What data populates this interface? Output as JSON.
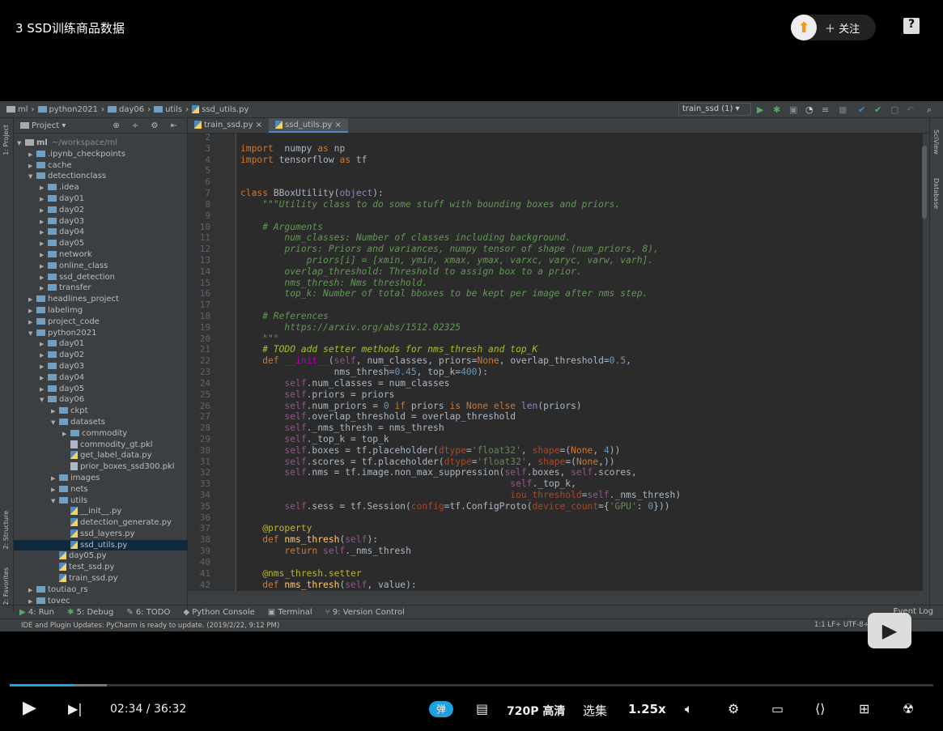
{
  "player": {
    "title": "3 SSD训练商品数据",
    "follow_label": "关注",
    "help_icon": "?",
    "time_current": "02:34",
    "time_total": "36:32",
    "played_fraction": 0.0705,
    "buffered_fraction": 0.105,
    "danmaku_label": "弹",
    "quality": "720P 高清",
    "episodes": "选集",
    "speed": "1.25x",
    "accent": "#1ea1e0"
  },
  "ide": {
    "breadcrumb": [
      "ml",
      "python2021",
      "day06",
      "utils",
      "ssd_utils.py"
    ],
    "run_config": "train_ssd (1)",
    "panel_title": "Project",
    "side_left": [
      "1: Project",
      "2: Structure",
      "2: Favorites"
    ],
    "side_right": [
      "SciView",
      "Database"
    ],
    "tabs": [
      {
        "label": "train_ssd.py",
        "active": false
      },
      {
        "label": "ssd_utils.py",
        "active": true
      }
    ],
    "tree": [
      {
        "l": 0,
        "t": "ml",
        "x": "~/workspace/ml",
        "o": 1
      },
      {
        "l": 1,
        "t": ".ipynb_checkpoints",
        "c": 1
      },
      {
        "l": 1,
        "t": "cache",
        "c": 1
      },
      {
        "l": 1,
        "t": "detectionclass",
        "o": 1
      },
      {
        "l": 2,
        "t": ".idea",
        "c": 1
      },
      {
        "l": 2,
        "t": "day01",
        "c": 1
      },
      {
        "l": 2,
        "t": "day02",
        "c": 1
      },
      {
        "l": 2,
        "t": "day03",
        "c": 1
      },
      {
        "l": 2,
        "t": "day04",
        "c": 1
      },
      {
        "l": 2,
        "t": "day05",
        "c": 1
      },
      {
        "l": 2,
        "t": "network",
        "c": 1
      },
      {
        "l": 2,
        "t": "online_class",
        "c": 1
      },
      {
        "l": 2,
        "t": "ssd_detection",
        "c": 1
      },
      {
        "l": 2,
        "t": "transfer",
        "c": 1
      },
      {
        "l": 1,
        "t": "headlines_project",
        "c": 1
      },
      {
        "l": 1,
        "t": "labelimg",
        "c": 1
      },
      {
        "l": 1,
        "t": "project_code",
        "c": 1
      },
      {
        "l": 1,
        "t": "python2021",
        "o": 1
      },
      {
        "l": 2,
        "t": "day01",
        "c": 1
      },
      {
        "l": 2,
        "t": "day02",
        "c": 1
      },
      {
        "l": 2,
        "t": "day03",
        "c": 1
      },
      {
        "l": 2,
        "t": "day04",
        "c": 1
      },
      {
        "l": 2,
        "t": "day05",
        "c": 1
      },
      {
        "l": 2,
        "t": "day06",
        "o": 1
      },
      {
        "l": 3,
        "t": "ckpt",
        "c": 1
      },
      {
        "l": 3,
        "t": "datasets",
        "o": 1
      },
      {
        "l": 4,
        "t": "commodity",
        "c": 1
      },
      {
        "l": 4,
        "t": "commodity_gt.pkl",
        "f": "file"
      },
      {
        "l": 4,
        "t": "get_label_data.py",
        "f": "py"
      },
      {
        "l": 4,
        "t": "prior_boxes_ssd300.pkl",
        "f": "file"
      },
      {
        "l": 3,
        "t": "images",
        "c": 1
      },
      {
        "l": 3,
        "t": "nets",
        "c": 1
      },
      {
        "l": 3,
        "t": "utils",
        "o": 1
      },
      {
        "l": 4,
        "t": "__init__.py",
        "f": "py"
      },
      {
        "l": 4,
        "t": "detection_generate.py",
        "f": "py"
      },
      {
        "l": 4,
        "t": "ssd_layers.py",
        "f": "py"
      },
      {
        "l": 4,
        "t": "ssd_utils.py",
        "f": "py",
        "sel": 1
      },
      {
        "l": 3,
        "t": "day05.py",
        "f": "py"
      },
      {
        "l": 3,
        "t": "test_ssd.py",
        "f": "py"
      },
      {
        "l": 3,
        "t": "train_ssd.py",
        "f": "py"
      },
      {
        "l": 1,
        "t": "toutiao_rs",
        "c": 1
      },
      {
        "l": 1,
        "t": "tovec",
        "c": 1
      }
    ],
    "first_line": 2,
    "code": [
      [],
      [
        [
          "k",
          "import"
        ],
        [
          "",
          "  numpy "
        ],
        [
          "k",
          "as"
        ],
        [
          "",
          " np"
        ]
      ],
      [
        [
          "k",
          "import"
        ],
        [
          "",
          " tensorflow "
        ],
        [
          "k",
          "as"
        ],
        [
          "",
          " tf"
        ]
      ],
      [],
      [],
      [
        [
          "k",
          "class"
        ],
        [
          "",
          " BBoxUtility("
        ],
        [
          "p",
          "object"
        ],
        [
          "",
          "):"
        ]
      ],
      [
        [
          "d",
          "    \"\"\"Utility class to do some stuff with bounding boxes and priors."
        ]
      ],
      [],
      [
        [
          "d",
          "    # Arguments"
        ]
      ],
      [
        [
          "d",
          "        num_classes: Number of classes including background."
        ]
      ],
      [
        [
          "d",
          "        priors: Priors and variances, numpy tensor of shape (num_priors, 8),"
        ]
      ],
      [
        [
          "d",
          "            priors[i] = [xmin, ymin, xmax, ymax, varxc, varyc, varw, varh]."
        ]
      ],
      [
        [
          "d",
          "        overlap_threshold: Threshold to assign box to a prior."
        ]
      ],
      [
        [
          "d",
          "        nms_thresh: Nms threshold."
        ]
      ],
      [
        [
          "d",
          "        top_k: Number of total bboxes to be kept per image after nms step."
        ]
      ],
      [],
      [
        [
          "d",
          "    # References"
        ]
      ],
      [
        [
          "d",
          "        https://arxiv.org/abs/1512.02325"
        ]
      ],
      [
        [
          "d",
          "    \"\"\""
        ]
      ],
      [
        [
          "todo",
          "    # TODO add setter methods for nms_thresh and top_K"
        ]
      ],
      [
        [
          "k",
          "    def "
        ],
        [
          "m",
          "__init__"
        ],
        [
          "",
          "("
        ],
        [
          "s",
          "self"
        ],
        [
          "",
          ", num_classes, priors="
        ],
        [
          "k",
          "None"
        ],
        [
          "",
          ", overlap_threshold="
        ],
        [
          "n",
          "0.5"
        ],
        [
          "",
          ","
        ]
      ],
      [
        [
          "",
          "                 nms_thresh="
        ],
        [
          "n",
          "0.45"
        ],
        [
          "",
          ", top_k="
        ],
        [
          "n",
          "400"
        ],
        [
          "",
          "):"
        ]
      ],
      [
        [
          "s",
          "        self"
        ],
        [
          "",
          ".num_classes = num_classes"
        ]
      ],
      [
        [
          "s",
          "        self"
        ],
        [
          "",
          ".priors = priors"
        ]
      ],
      [
        [
          "s",
          "        self"
        ],
        [
          "",
          ".num_priors = "
        ],
        [
          "n",
          "0"
        ],
        [
          "k",
          " if"
        ],
        [
          "",
          " priors "
        ],
        [
          "k",
          "is None else "
        ],
        [
          "p",
          "len"
        ],
        [
          "",
          "(priors)"
        ]
      ],
      [
        [
          "s",
          "        self"
        ],
        [
          "",
          ".overlap_threshold = overlap_threshold"
        ]
      ],
      [
        [
          "s",
          "        self"
        ],
        [
          "",
          "._nms_thresh = nms_thresh"
        ]
      ],
      [
        [
          "s",
          "        self"
        ],
        [
          "",
          "._top_k = top_k"
        ]
      ],
      [
        [
          "s",
          "        self"
        ],
        [
          "",
          ".boxes = tf.placeholder("
        ],
        [
          "kw",
          "dtype"
        ],
        [
          "",
          "="
        ],
        [
          "st",
          "'float32'"
        ],
        [
          "",
          ", "
        ],
        [
          "kw",
          "shape"
        ],
        [
          "",
          "=("
        ],
        [
          "k",
          "None"
        ],
        [
          "",
          ", "
        ],
        [
          "n",
          "4"
        ],
        [
          "",
          "))"
        ]
      ],
      [
        [
          "s",
          "        self"
        ],
        [
          "",
          ".scores = tf.placeholder("
        ],
        [
          "kw",
          "dtype"
        ],
        [
          "",
          "="
        ],
        [
          "st",
          "'float32'"
        ],
        [
          "",
          ", "
        ],
        [
          "kw",
          "shape"
        ],
        [
          "",
          "=("
        ],
        [
          "k",
          "None"
        ],
        [
          "",
          ",))"
        ]
      ],
      [
        [
          "s",
          "        self"
        ],
        [
          "",
          ".nms = tf.image.non_max_suppression("
        ],
        [
          "s",
          "self"
        ],
        [
          "",
          ".boxes, "
        ],
        [
          "s",
          "self"
        ],
        [
          "",
          ".scores,"
        ]
      ],
      [
        [
          "s",
          "                                                 self"
        ],
        [
          "",
          "._top_k,"
        ]
      ],
      [
        [
          "kw",
          "                                                 iou_threshold"
        ],
        [
          "",
          "="
        ],
        [
          "s",
          "self"
        ],
        [
          "",
          "._nms_thresh)"
        ]
      ],
      [
        [
          "s",
          "        self"
        ],
        [
          "",
          ".sess = tf.Session("
        ],
        [
          "kw",
          "config"
        ],
        [
          "",
          "=tf.ConfigProto("
        ],
        [
          "kw",
          "device_count"
        ],
        [
          "",
          "={"
        ],
        [
          "st",
          "'GPU'"
        ],
        [
          "",
          ": "
        ],
        [
          "n",
          "0"
        ],
        [
          "",
          "}))"
        ]
      ],
      [],
      [
        [
          "dec",
          "    @property"
        ]
      ],
      [
        [
          "k",
          "    def "
        ],
        [
          "f",
          "nms_thresh"
        ],
        [
          "",
          "("
        ],
        [
          "s",
          "self"
        ],
        [
          "",
          "):"
        ]
      ],
      [
        [
          "k",
          "        return "
        ],
        [
          "s",
          "self"
        ],
        [
          "",
          "._nms_thresh"
        ]
      ],
      [],
      [
        [
          "dec",
          "    @nms_thresh.setter"
        ]
      ],
      [
        [
          "k",
          "    def "
        ],
        [
          "f",
          "nms_thresh"
        ],
        [
          "",
          "("
        ],
        [
          "s",
          "self"
        ],
        [
          "",
          ", value):"
        ]
      ]
    ],
    "toolwindows": [
      "4: Run",
      "5: Debug",
      "6: TODO",
      "Python Console",
      "Terminal",
      "9: Version Control"
    ],
    "event_log": "Event Log",
    "status_message": "IDE and Plugin Updates: PyCharm is ready to update. (2019/2/22, 9:12 PM)",
    "status_right": "1:1  LF÷  UTF-8÷"
  }
}
